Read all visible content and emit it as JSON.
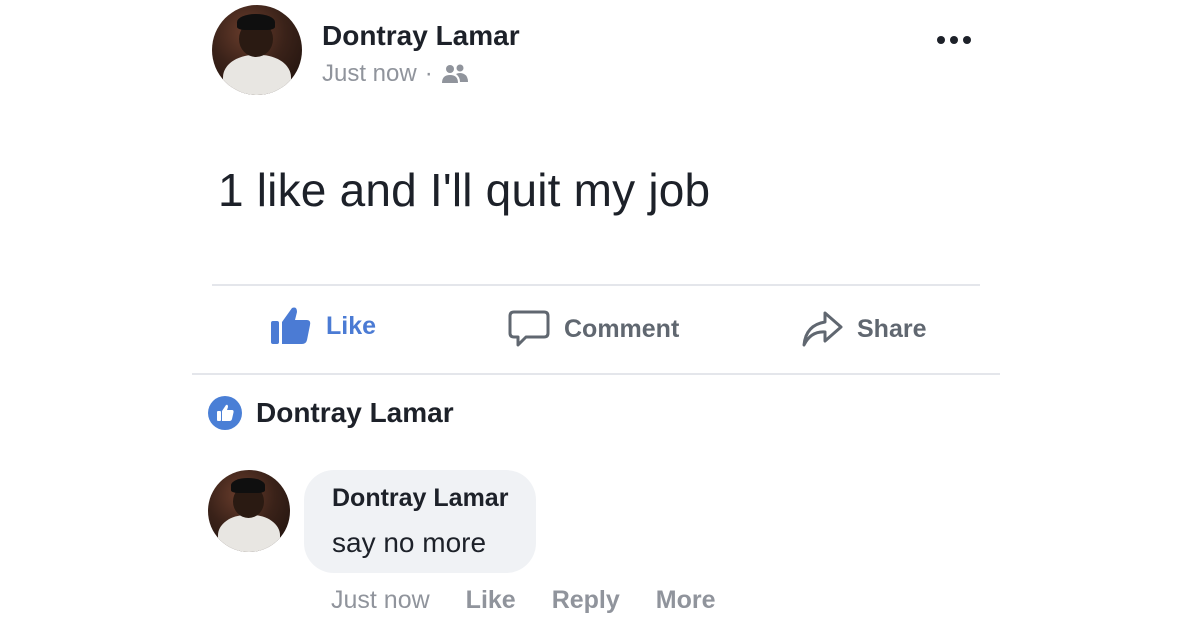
{
  "post": {
    "author": "Dontray Lamar",
    "time": "Just now",
    "separator": "·",
    "audience_icon": "friends-icon",
    "more_icon": "more-dots-icon",
    "text": "1 like and I'll quit my job"
  },
  "actions": {
    "like": "Like",
    "comment": "Comment",
    "share": "Share"
  },
  "reactions": {
    "icon": "like-badge-icon",
    "name": "Dontray Lamar"
  },
  "comment": {
    "author": "Dontray Lamar",
    "text": "say no more",
    "time": "Just now",
    "like": "Like",
    "reply": "Reply",
    "more": "More"
  },
  "colors": {
    "accent": "#4b7bd4",
    "muted": "#90949c",
    "text": "#1d2129",
    "bubble": "#f0f2f5"
  }
}
